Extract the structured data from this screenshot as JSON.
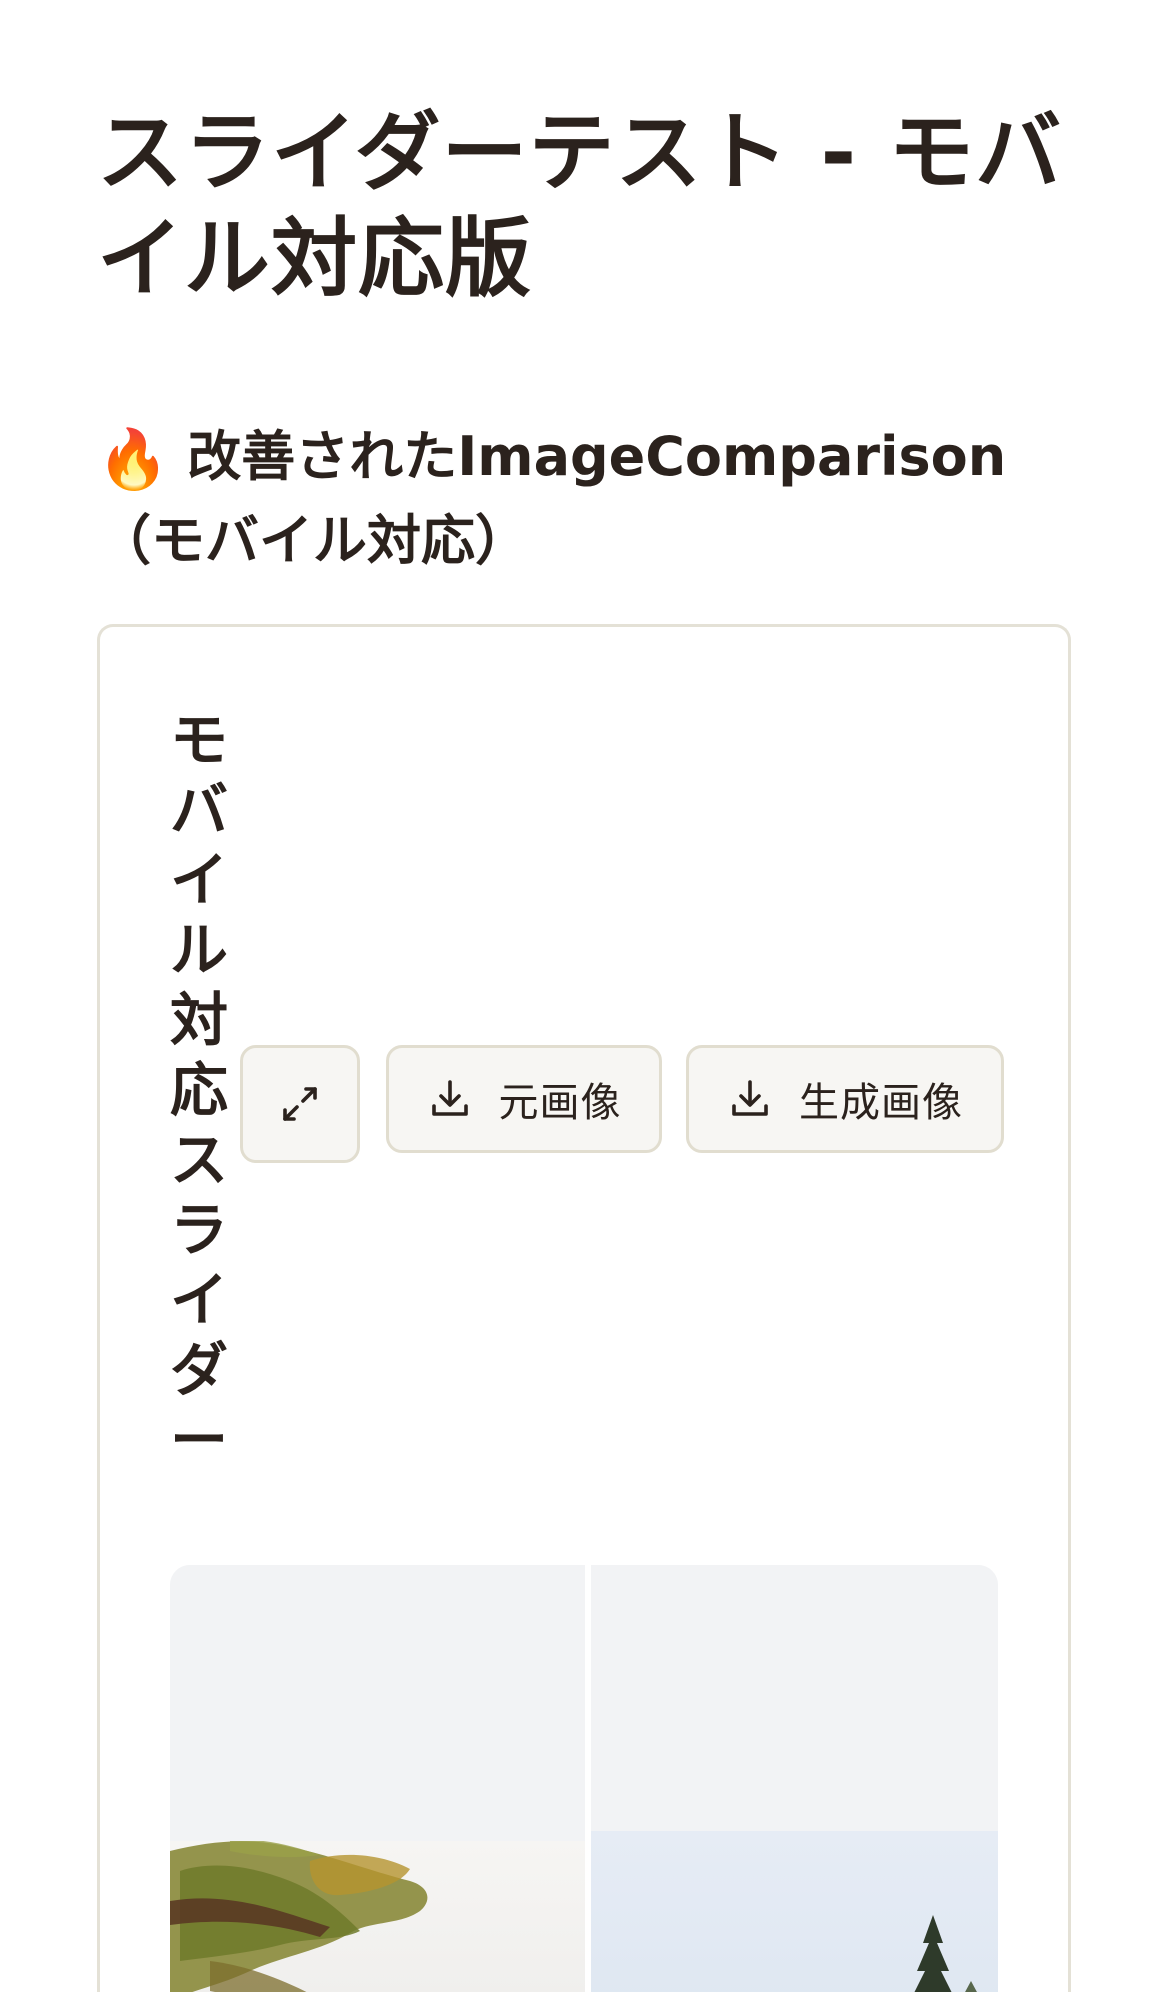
{
  "page": {
    "title": "スライダーテスト - モバイル対応版"
  },
  "section": {
    "icon": "fire-icon",
    "icon_glyph": "🔥",
    "heading": "改善されたImageComparison（モバイル対応）"
  },
  "card": {
    "title": "モバイル対応スライダー",
    "toolbar": {
      "expand_icon": "expand-icon",
      "original_icon": "download-icon",
      "original_label": "元画像",
      "generated_icon": "download-icon",
      "generated_label": "生成画像"
    }
  },
  "comparison": {
    "left_image": "original-photo",
    "right_image": "generated-photo"
  },
  "colors": {
    "text": "#2b221d",
    "button_bg": "#f7f6f3",
    "button_border": "#e1ddcf",
    "card_border": "#e4e1d6",
    "image_placeholder": "#f2f3f5",
    "right_sky": "#dde6f1"
  }
}
